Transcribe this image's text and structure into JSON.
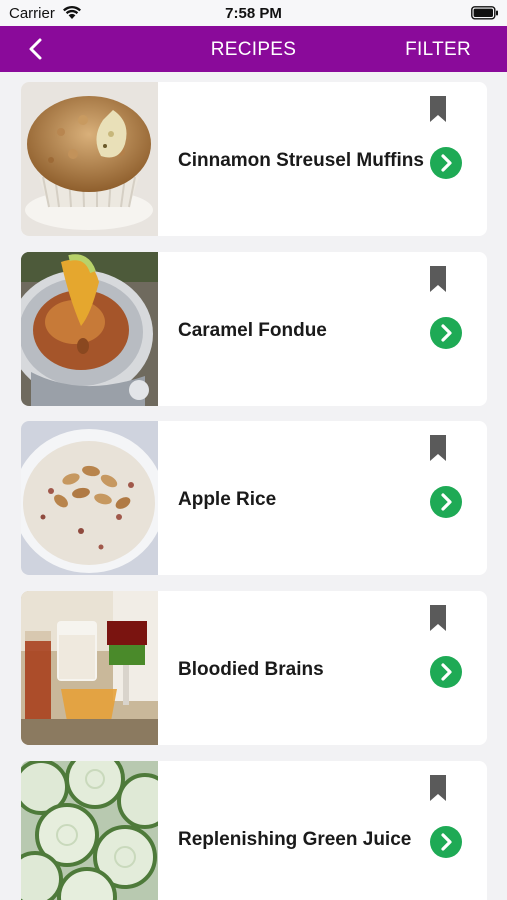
{
  "status": {
    "carrier": "Carrier",
    "time": "7:58 PM"
  },
  "nav": {
    "title": "RECIPES",
    "filter": "FILTER",
    "color": "#8a0a9a"
  },
  "recipes": [
    {
      "title": "Cinnamon Streusel Muffins",
      "photo": "muffin-photo"
    },
    {
      "title": "Caramel Fondue",
      "photo": "fondue-photo"
    },
    {
      "title": "Apple Rice",
      "photo": "rice-photo"
    },
    {
      "title": "Bloodied Brains",
      "photo": "drinks-photo"
    },
    {
      "title": "Replenishing Green Juice",
      "photo": "cucumber-photo"
    }
  ],
  "colors": {
    "go": "#1eaa55",
    "bookmark": "#5a5a5a",
    "background": "#f2f2f4"
  }
}
